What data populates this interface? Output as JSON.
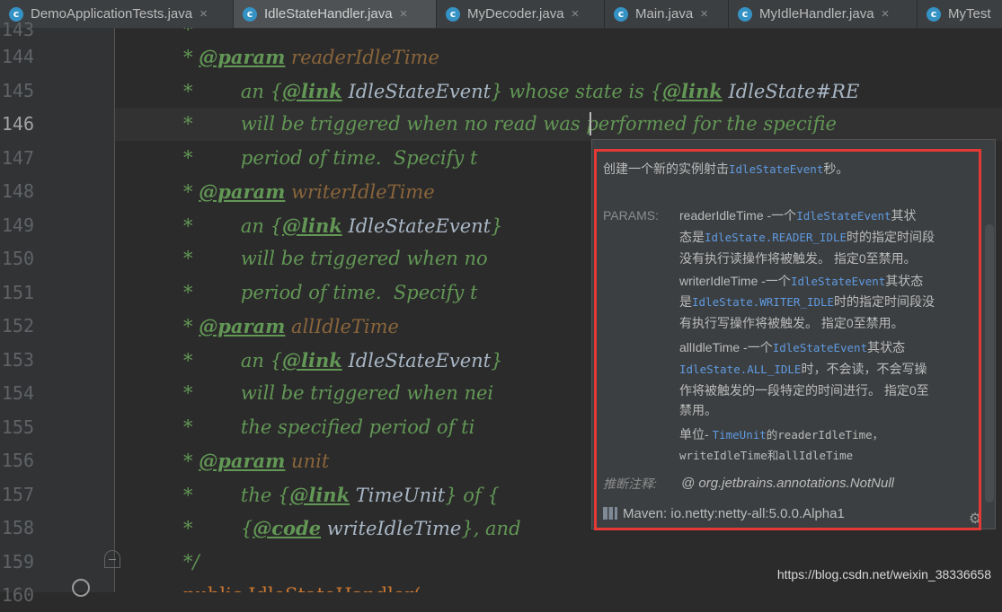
{
  "tabs": [
    {
      "label": "DemoApplicationTests.java",
      "close": "×",
      "active": false
    },
    {
      "label": "IdleStateHandler.java",
      "close": "×",
      "active": true
    },
    {
      "label": "MyDecoder.java",
      "close": "×",
      "active": false
    },
    {
      "label": "Main.java",
      "close": "×",
      "active": false
    },
    {
      "label": "MyIdleHandler.java",
      "close": "×",
      "active": false
    },
    {
      "label": "MyTest",
      "close": "",
      "active": false
    }
  ],
  "tab_icon_letter": "c",
  "line_numbers": [
    "143",
    "144",
    "145",
    "146",
    "147",
    "148",
    "149",
    "150",
    "151",
    "152",
    "153",
    "154",
    "155",
    "156",
    "157",
    "158",
    "159",
    "160"
  ],
  "current_line": "146",
  "code": {
    "l144": {
      "star": "* ",
      "tag": "@param",
      "name": " readerIdleTime"
    },
    "l145": {
      "pre": "*        an {",
      "tag": "@link",
      "ref": " IdleStateEvent",
      "mid": "} whose state is {",
      "tag2": "@link",
      "ref2": " IdleState#RE"
    },
    "l146": {
      "text": "*        will be triggered when no read was performed for the specifie"
    },
    "l147": {
      "text": "*        period of time.  Specify t"
    },
    "l148": {
      "star": "* ",
      "tag": "@param",
      "name": " writerIdleTime"
    },
    "l149": {
      "pre": "*        an {",
      "tag": "@link",
      "ref": " IdleStateEvent",
      "mid": "}"
    },
    "l150": {
      "text": "*        will be triggered when no"
    },
    "l151": {
      "text": "*        period of time.  Specify t"
    },
    "l152": {
      "star": "* ",
      "tag": "@param",
      "name": " allIdleTime"
    },
    "l153": {
      "pre": "*        an {",
      "tag": "@link",
      "ref": " IdleStateEvent",
      "mid": "}"
    },
    "l154": {
      "text": "*        will be triggered when nei"
    },
    "l155": {
      "text": "*        the specified period of ti"
    },
    "l156": {
      "star": "* ",
      "tag": "@param",
      "name": " unit"
    },
    "l157": {
      "pre": "*        the {",
      "tag": "@link",
      "ref": " TimeUnit",
      "mid": "} of {"
    },
    "l158": {
      "pre": "*        {",
      "tag": "@code",
      "ref": " writeIdleTime",
      "mid": "}, and"
    },
    "l159": {
      "text": "*/"
    },
    "l160": {
      "text": "public IdleStateHandler("
    }
  },
  "popup": {
    "summary_pre": "创建一个新的实例射击",
    "summary_code": "IdleStateEvent",
    "summary_post": "秒。",
    "params_label": "PARAMS:",
    "p1_a": "readerIdleTime -一个",
    "p1_b": "IdleStateEvent",
    "p1_c": "其状",
    "p1_d": "态是",
    "p1_e": "IdleState.READER_IDLE",
    "p1_f": "时的指定时间段",
    "p1_g": "没有执行读操作将被触发。 指定0至禁用。",
    "p2_a": "writerIdleTime -一个",
    "p2_b": "IdleStateEvent",
    "p2_c": "其状态",
    "p2_d": "是",
    "p2_e": "IdleState.WRITER_IDLE",
    "p2_f": "时的指定时间段没",
    "p2_g": "有执行写操作将被触发。 指定0至禁用。",
    "p3_a": "allIdleTime -一个",
    "p3_b": "IdleStateEvent",
    "p3_c": "其状态",
    "p3_d": "IdleState.ALL_IDLE",
    "p3_e": "时，不会读，不会写操",
    "p3_f": "作将被触发的一段特定的时间进行。 指定0至",
    "p3_g": "禁用。",
    "p4_a": "单位- ",
    "p4_b": "TimeUnit",
    "p4_c": "的readerIdleTime，",
    "p4_d": "writeIdleTime和allIdleTime",
    "inferred_label": "推断注释:",
    "inferred_value": "@ org.jetbrains.annotations.NotNull",
    "maven": "Maven: io.netty:netty-all:5.0.0.Alpha1"
  },
  "watermark": "https://blog.csdn.net/weixin_38336658",
  "colors": {
    "accent_red": "#e53935",
    "link_blue": "#5f9ae0",
    "comment_green": "#629755"
  },
  "icons": [
    "java-class-icon",
    "close-icon",
    "maven-library-icon",
    "gear-icon",
    "fold-icon",
    "annotation-icon"
  ]
}
